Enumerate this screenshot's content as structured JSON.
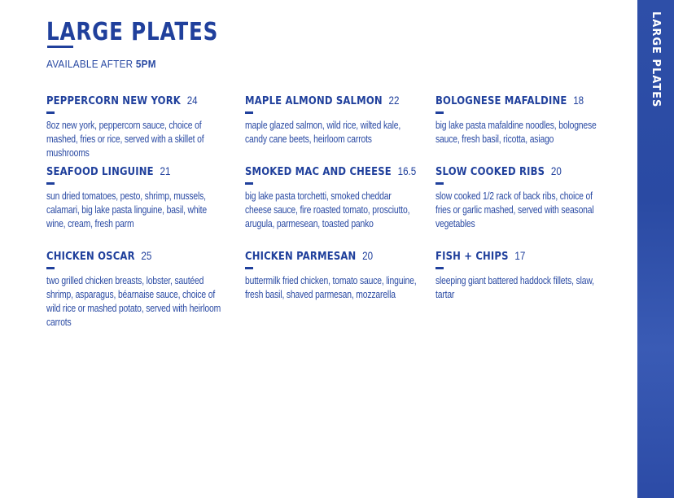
{
  "header": {
    "title": "LARGE PLATES",
    "subtitle_prefix": "AVAILABLE AFTER",
    "subtitle_time": "5PM"
  },
  "side_band": {
    "label": "LARGE PLATES"
  },
  "colors": {
    "accent": "#20409c",
    "band": "#2e4fa8"
  },
  "items": [
    {
      "name": "PEPPERCORN NEW YORK",
      "price": "24",
      "desc": "8oz new york, peppercorn sauce, choice of mashed, fries or rice, served with a skillet of mushrooms"
    },
    {
      "name": "MAPLE ALMOND SALMON",
      "price": "22",
      "desc": "maple glazed salmon, wild rice, wilted kale, candy cane beets, heirloom carrots"
    },
    {
      "name": "BOLOGNESE MAFALDINE",
      "price": "18",
      "desc": "big lake pasta mafaldine noodles, bolognese sauce, fresh basil, ricotta, asiago"
    },
    {
      "name": "SEAFOOD LINGUINE",
      "price": "21",
      "desc": "sun dried tomatoes, pesto, shrimp, mussels, calamari, big lake pasta linguine, basil, white wine, cream, fresh parm"
    },
    {
      "name": "SMOKED MAC AND CHEESE",
      "price": "16.5",
      "desc": "big lake pasta torchetti, smoked cheddar cheese sauce, fire roasted tomato, prosciutto, arugula, parmesean, toasted panko"
    },
    {
      "name": "SLOW COOKED RIBS",
      "price": "20",
      "desc": "slow cooked 1/2 rack of back ribs, choice of fries or garlic mashed, served with seasonal vegetables"
    },
    {
      "name": "CHICKEN OSCAR",
      "price": "25",
      "desc": "two grilled chicken breasts, lobster, sautéed shrimp, asparagus, béarnaise sauce, choice of wild rice or mashed potato, served with heirloom carrots"
    },
    {
      "name": "CHICKEN PARMESAN",
      "price": "20",
      "desc": "buttermilk fried chicken, tomato sauce, linguine, fresh basil, shaved parmesan, mozzarella"
    },
    {
      "name": "FISH + CHIPS",
      "price": "17",
      "desc": "sleeping giant battered haddock fillets, slaw, tartar"
    }
  ]
}
